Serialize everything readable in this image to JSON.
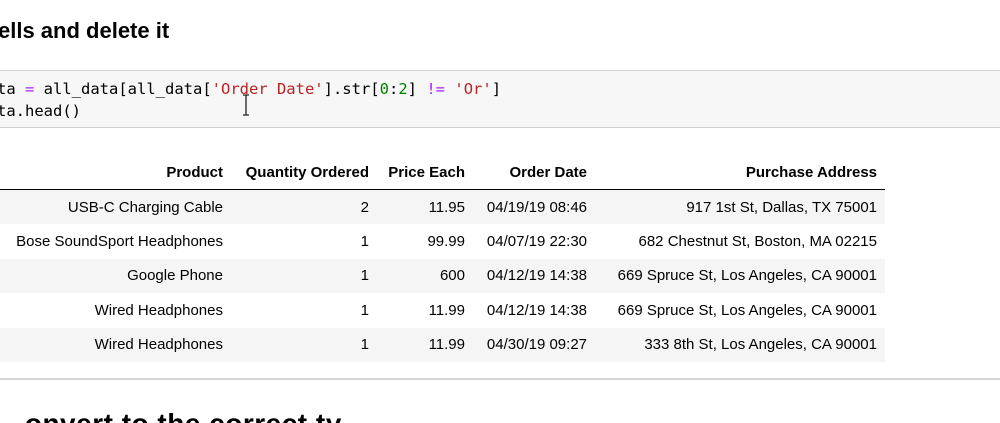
{
  "heading": "ells and delete it",
  "code": {
    "line1": {
      "a": "ta ",
      "eq": "=",
      "b": " all_data[all_data[",
      "s1": "'Order Date'",
      "c": "].str[",
      "n1": "0",
      "colon": ":",
      "n2": "2",
      "d": "] ",
      "ne": "!=",
      "e": " ",
      "s2": "'Or'",
      "f": "]"
    },
    "line2": "ta.head()"
  },
  "table": {
    "headers": [
      "Product",
      "Quantity Ordered",
      "Price Each",
      "Order Date",
      "Purchase Address"
    ],
    "rows": [
      [
        "USB-C Charging Cable",
        "2",
        "11.95",
        "04/19/19 08:46",
        "917 1st St, Dallas, TX 75001"
      ],
      [
        "Bose SoundSport Headphones",
        "1",
        "99.99",
        "04/07/19 22:30",
        "682 Chestnut St, Boston, MA 02215"
      ],
      [
        "Google Phone",
        "1",
        "600",
        "04/12/19 14:38",
        "669 Spruce St, Los Angeles, CA 90001"
      ],
      [
        "Wired Headphones",
        "1",
        "11.99",
        "04/12/19 14:38",
        "669 Spruce St, Los Angeles, CA 90001"
      ],
      [
        "Wired Headphones",
        "1",
        "11.99",
        "04/30/19 09:27",
        "333 8th St, Los Angeles, CA 90001"
      ]
    ]
  },
  "heading2": "...onvert to the correct ty..."
}
